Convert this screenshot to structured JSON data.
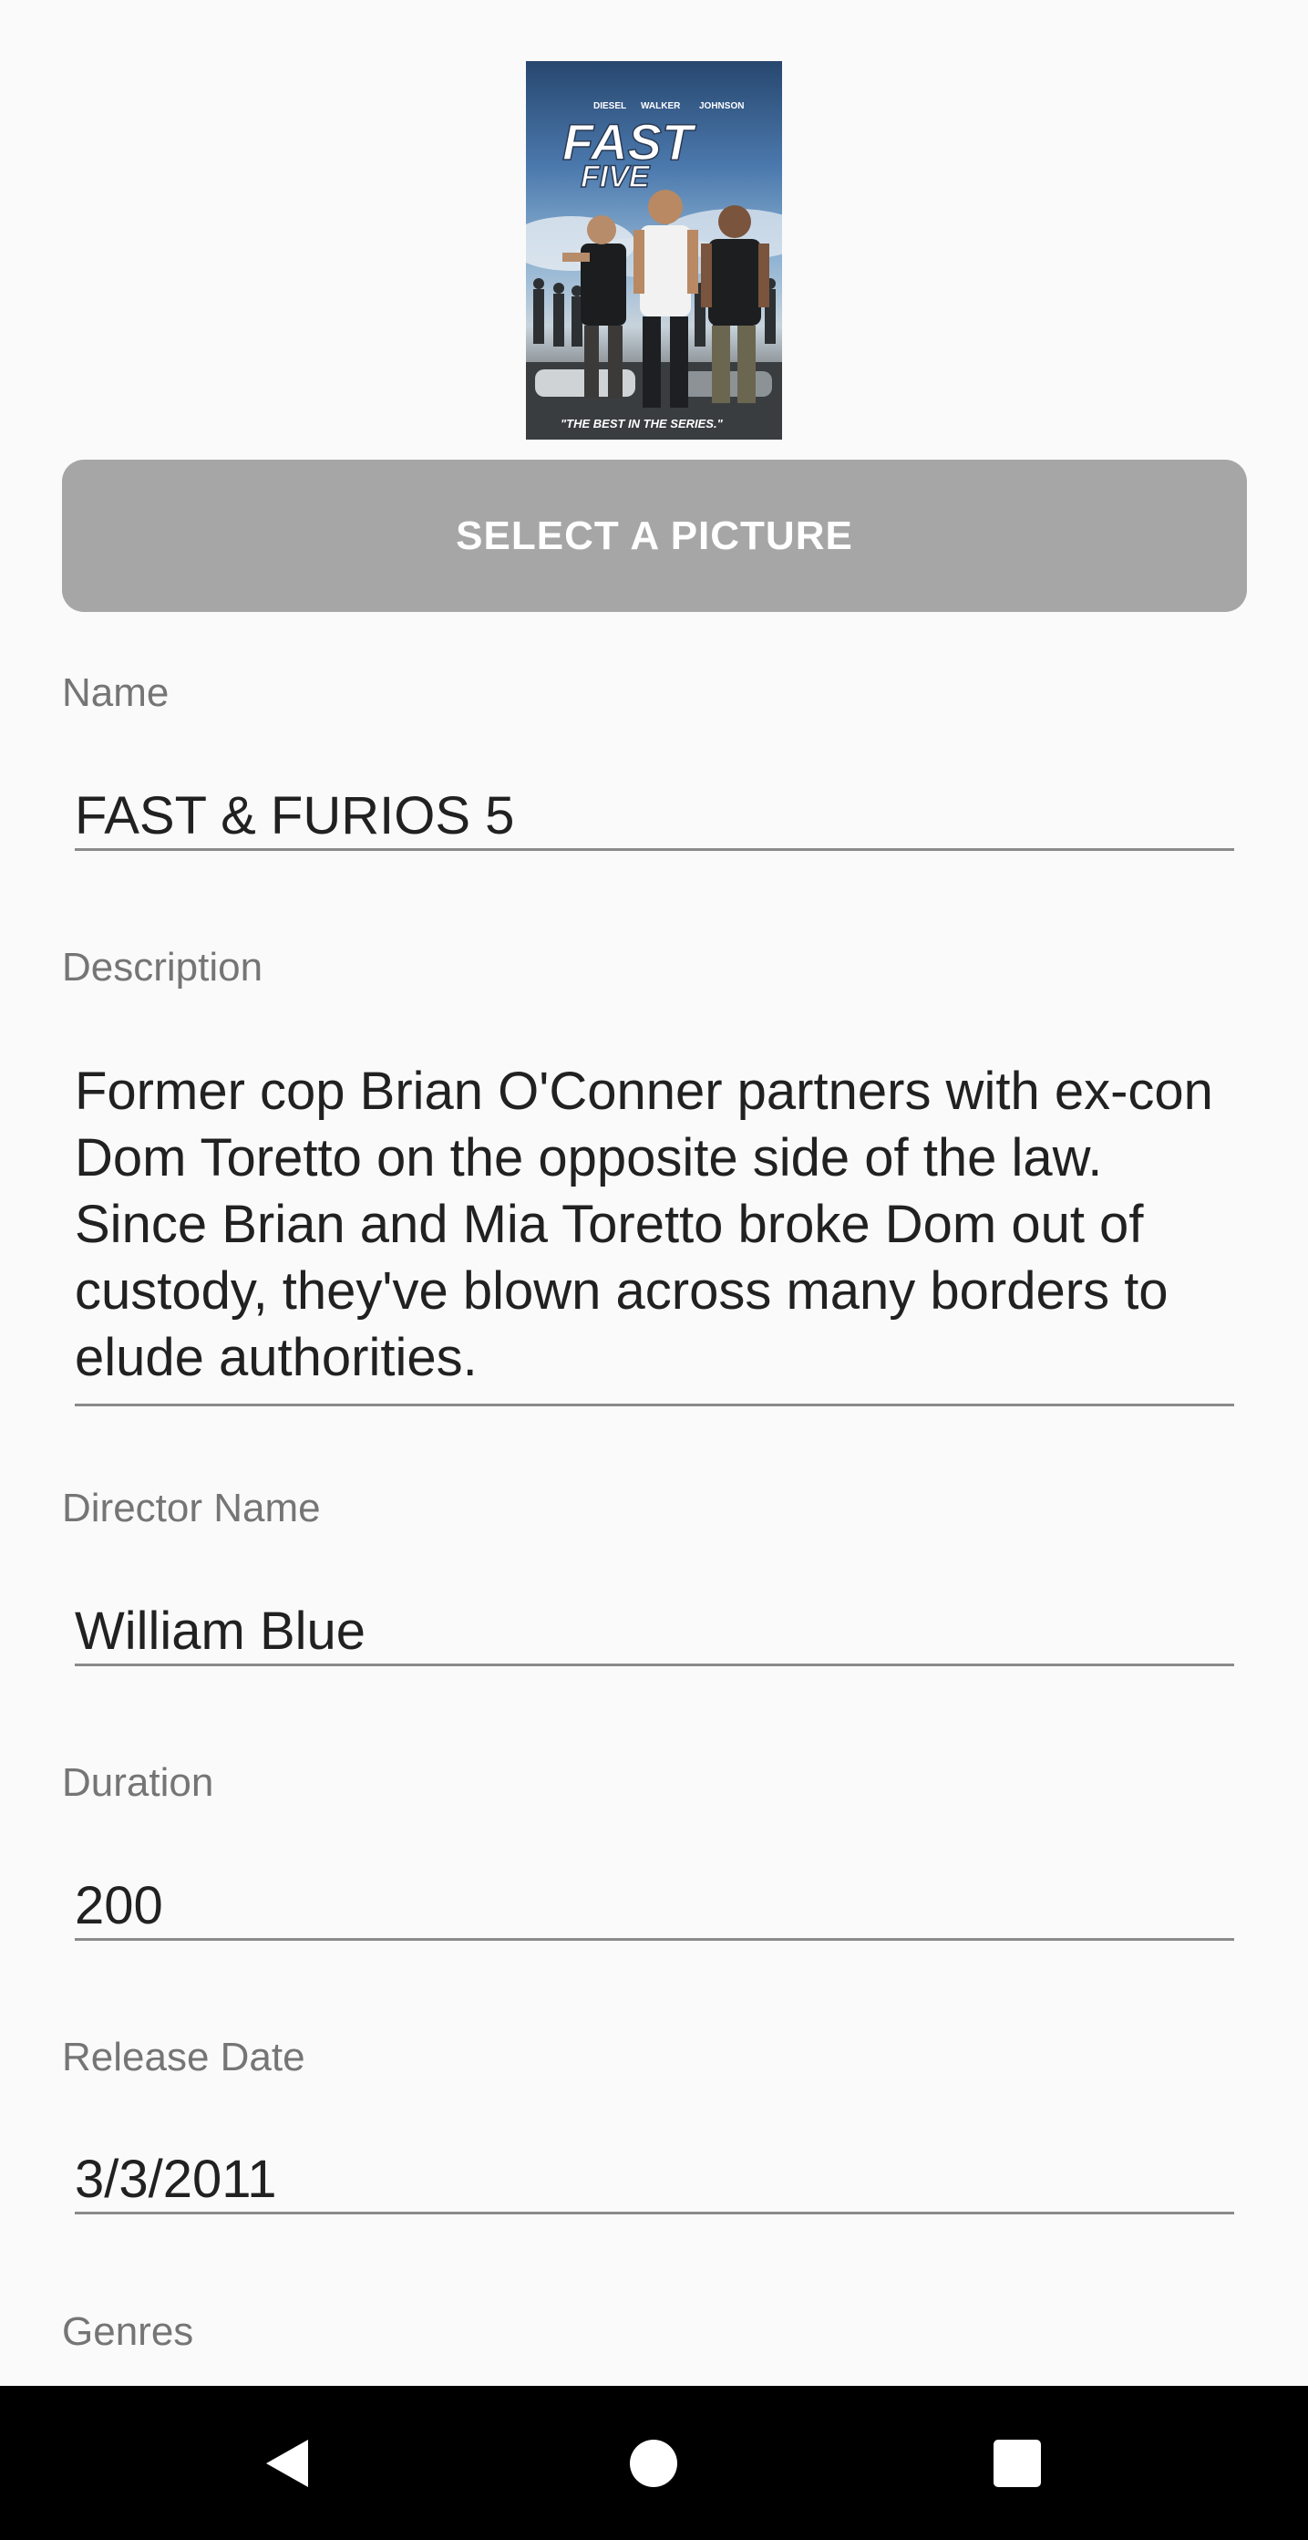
{
  "poster": {
    "top_names": [
      "DIESEL",
      "WALKER",
      "JOHNSON"
    ],
    "title_line1": "FAST",
    "title_line2": "FIVE",
    "tagline": "\"THE BEST IN THE SERIES.\""
  },
  "select_picture_label": "SELECT A PICTURE",
  "form": {
    "name": {
      "label": "Name",
      "value": "FAST & FURIOS 5"
    },
    "description": {
      "label": "Description",
      "value": "Former cop Brian O'Conner partners with ex-con Dom Toretto on the opposite side of the law. Since Brian and Mia Toretto broke Dom out of custody, they've blown across many borders to elude authorities."
    },
    "director": {
      "label": "Director Name",
      "value": "William Blue"
    },
    "duration": {
      "label": "Duration",
      "value": "200"
    },
    "release_date": {
      "label": "Release Date",
      "value": "3/3/2011"
    },
    "genres": {
      "label": "Genres"
    }
  },
  "navbar": {
    "icons": [
      "back-icon",
      "home-icon",
      "recents-icon"
    ]
  }
}
